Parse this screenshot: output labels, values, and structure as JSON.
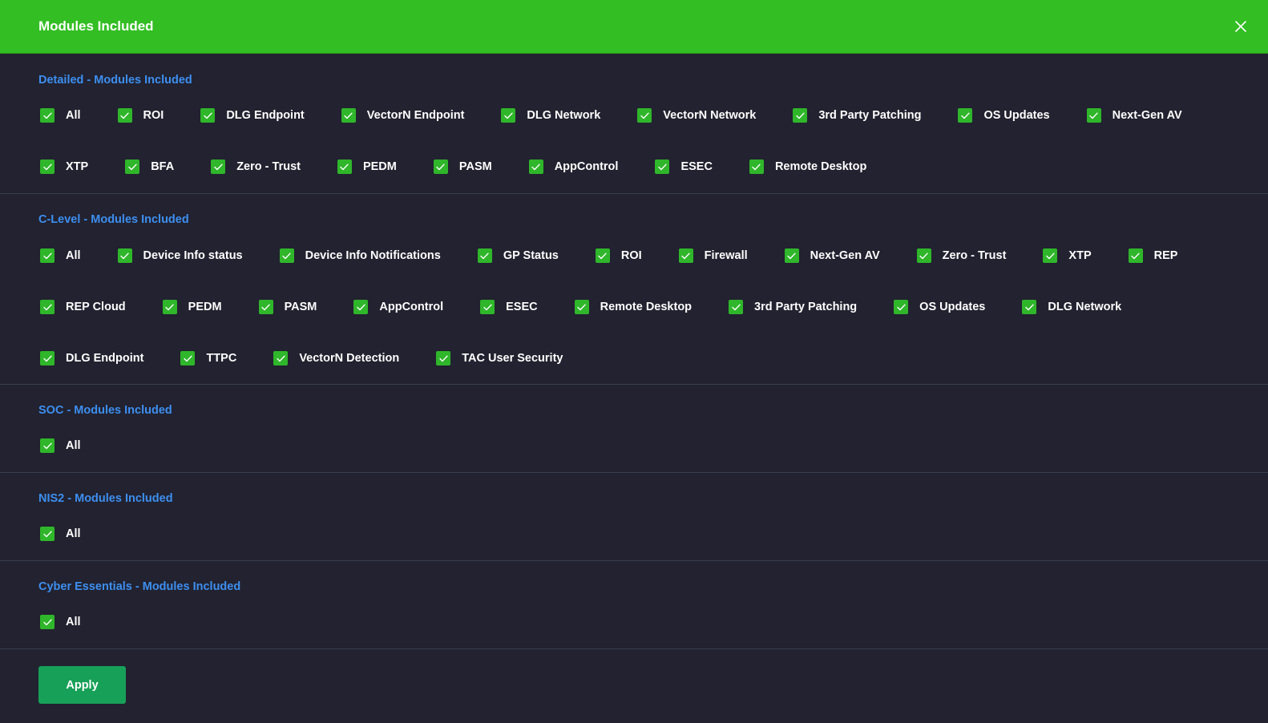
{
  "modal": {
    "title": "Modules Included",
    "close_icon": "close-icon",
    "apply_label": "Apply"
  },
  "colors": {
    "header": "#33be23",
    "background": "#222230",
    "section_title": "#3d8ff0",
    "checkbox": "#2fb62a",
    "apply": "#17a058"
  },
  "sections": [
    {
      "id": "detailed",
      "title": "Detailed - Modules Included",
      "options": [
        {
          "label": "All",
          "checked": true
        },
        {
          "label": "ROI",
          "checked": true
        },
        {
          "label": "DLG Endpoint",
          "checked": true
        },
        {
          "label": "VectorN Endpoint",
          "checked": true
        },
        {
          "label": "DLG Network",
          "checked": true
        },
        {
          "label": "VectorN Network",
          "checked": true
        },
        {
          "label": "3rd Party Patching",
          "checked": true
        },
        {
          "label": "OS Updates",
          "checked": true
        },
        {
          "label": "Next-Gen AV",
          "checked": true
        },
        {
          "label": "XTP",
          "checked": true
        },
        {
          "label": "BFA",
          "checked": true
        },
        {
          "label": "Zero - Trust",
          "checked": true
        },
        {
          "label": "PEDM",
          "checked": true
        },
        {
          "label": "PASM",
          "checked": true
        },
        {
          "label": "AppControl",
          "checked": true
        },
        {
          "label": "ESEC",
          "checked": true
        },
        {
          "label": "Remote Desktop",
          "checked": true
        }
      ]
    },
    {
      "id": "clevel",
      "title": "C-Level - Modules Included",
      "options": [
        {
          "label": "All",
          "checked": true
        },
        {
          "label": "Device Info status",
          "checked": true
        },
        {
          "label": "Device Info Notifications",
          "checked": true
        },
        {
          "label": "GP Status",
          "checked": true
        },
        {
          "label": "ROI",
          "checked": true
        },
        {
          "label": "Firewall",
          "checked": true
        },
        {
          "label": "Next-Gen AV",
          "checked": true
        },
        {
          "label": "Zero - Trust",
          "checked": true
        },
        {
          "label": "XTP",
          "checked": true
        },
        {
          "label": "REP",
          "checked": true
        },
        {
          "label": "REP Cloud",
          "checked": true
        },
        {
          "label": "PEDM",
          "checked": true
        },
        {
          "label": "PASM",
          "checked": true
        },
        {
          "label": "AppControl",
          "checked": true
        },
        {
          "label": "ESEC",
          "checked": true
        },
        {
          "label": "Remote Desktop",
          "checked": true
        },
        {
          "label": "3rd Party Patching",
          "checked": true
        },
        {
          "label": "OS Updates",
          "checked": true
        },
        {
          "label": "DLG Network",
          "checked": true
        },
        {
          "label": "DLG Endpoint",
          "checked": true
        },
        {
          "label": "TTPC",
          "checked": true
        },
        {
          "label": "VectorN Detection",
          "checked": true
        },
        {
          "label": "TAC User Security",
          "checked": true
        }
      ]
    },
    {
      "id": "soc",
      "title": "SOC - Modules Included",
      "options": [
        {
          "label": "All",
          "checked": true
        }
      ]
    },
    {
      "id": "nis2",
      "title": "NIS2 - Modules Included",
      "options": [
        {
          "label": "All",
          "checked": true
        }
      ]
    },
    {
      "id": "cyber",
      "title": "Cyber Essentials - Modules Included",
      "options": [
        {
          "label": "All",
          "checked": true
        }
      ]
    }
  ]
}
